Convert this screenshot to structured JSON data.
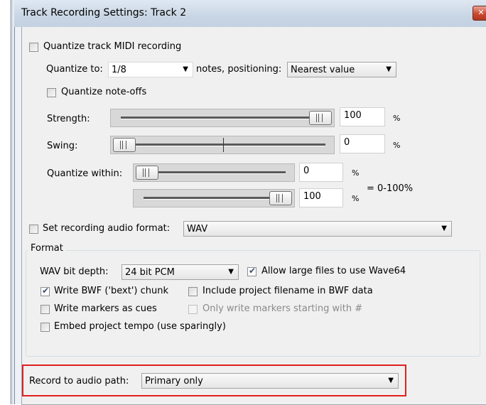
{
  "window": {
    "title": "Track Recording Settings: Track 2",
    "close_icon": "close-icon"
  },
  "quantize": {
    "enable_label": "Quantize track MIDI recording",
    "quantize_to_label": "Quantize to:",
    "quantize_to_value": "1/8",
    "notes_positioning_label": "notes, positioning:",
    "positioning_value": "Nearest value",
    "note_offs_label": "Quantize note-offs",
    "strength_label": "Strength:",
    "strength_value": "100",
    "strength_level_pct": 100,
    "swing_label": "Swing:",
    "swing_value": "0",
    "swing_level_pct": 0,
    "within_label": "Quantize within:",
    "within_min_value": "0",
    "within_max_value": "100",
    "range_note": "= 0-100%",
    "pct": "%"
  },
  "audio": {
    "set_format_label": "Set recording audio format:",
    "format_value": "WAV",
    "format_group_label": "Format",
    "bit_depth_label": "WAV bit depth:",
    "bit_depth_value": "24 bit PCM",
    "wave64_label": "Allow large files to use Wave64",
    "bwf_label": "Write BWF ('bext') chunk",
    "include_filename_label": "Include project filename in BWF data",
    "markers_label": "Write markers as cues",
    "only_markers_label": "Only write markers starting with #",
    "tempo_label": "Embed project tempo (use sparingly)"
  },
  "record_path": {
    "label": "Record to audio path:",
    "value": "Primary only"
  }
}
